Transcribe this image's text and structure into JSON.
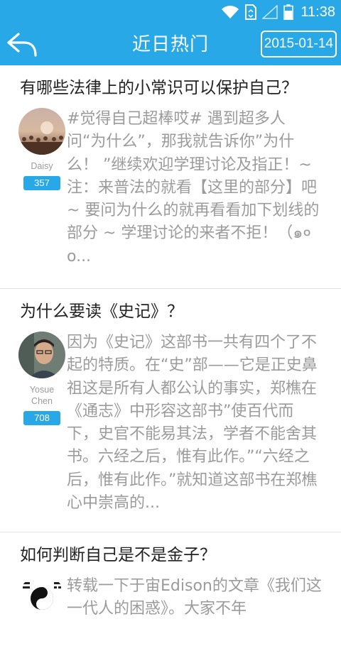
{
  "status": {
    "time": "11:38"
  },
  "header": {
    "title": "近日热门",
    "date": "2015-01-14"
  },
  "colors": {
    "accent": "#29a8e8",
    "excerpt_text": "#9b9b9b",
    "divider": "#e2e2e2"
  },
  "icons": {
    "back": "back-arrow-icon",
    "wifi": "wifi-icon",
    "sim": "sim-card-icon",
    "signal": "cell-signal-icon",
    "battery": "battery-icon"
  },
  "items": [
    {
      "title": "有哪些法律上的小常识可以保护自己？",
      "author": "Daisy",
      "votes": "357",
      "excerpt": "#觉得自己超棒哎# 遇到超多人问“为什么”，那我就告诉你”为什么！ ”继续欢迎学理讨论及指正！~注：来普法的就看【这里的部分】吧 ~ 要问为什么的就再看看加下划线的部分 ~ 学理讨论的来者不拒！（๑० o..."
    },
    {
      "title": "为什么要读《史记》？",
      "author": "Yosue Chen",
      "votes": "708",
      "excerpt": "因为《史记》这部书一共有四个了不起的特质。在“史”部——它是正史鼻祖这是所有人都公认的事实，郑樵在《通志》中形容这部书”使百代而下，史官不能易其法，学者不能舍其书。六经之后，惟有此作。”“六经之后，惟有此作。”就知道这部书在郑樵心中崇高的..."
    },
    {
      "title": "如何判断自己是不是金子？",
      "author": "",
      "votes": "",
      "excerpt": "转载一下于宙Edison的文章《我们这一代人的困惑》。大家不年"
    }
  ]
}
